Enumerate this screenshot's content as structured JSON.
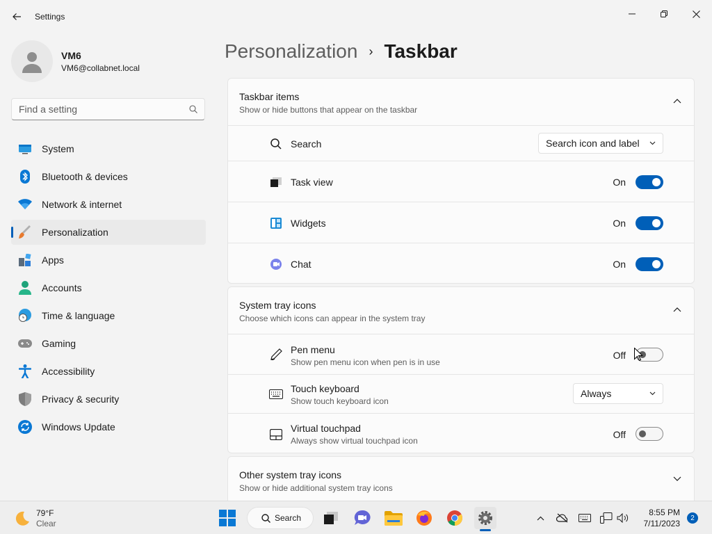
{
  "window": {
    "title": "Settings"
  },
  "profile": {
    "name": "VM6",
    "email": "VM6@collabnet.local"
  },
  "search": {
    "placeholder": "Find a setting"
  },
  "sidebar": {
    "items": [
      {
        "label": "System",
        "icon": "system-icon"
      },
      {
        "label": "Bluetooth & devices",
        "icon": "bluetooth-icon"
      },
      {
        "label": "Network & internet",
        "icon": "wifi-icon"
      },
      {
        "label": "Personalization",
        "icon": "brush-icon",
        "active": true
      },
      {
        "label": "Apps",
        "icon": "apps-icon"
      },
      {
        "label": "Accounts",
        "icon": "person-icon"
      },
      {
        "label": "Time & language",
        "icon": "globe-clock-icon"
      },
      {
        "label": "Gaming",
        "icon": "gamepad-icon"
      },
      {
        "label": "Accessibility",
        "icon": "accessibility-icon"
      },
      {
        "label": "Privacy & security",
        "icon": "shield-icon"
      },
      {
        "label": "Windows Update",
        "icon": "update-icon"
      }
    ]
  },
  "breadcrumb": {
    "parent": "Personalization",
    "separator": "›",
    "current": "Taskbar"
  },
  "taskbar_items": {
    "title": "Taskbar items",
    "subtitle": "Show or hide buttons that appear on the taskbar",
    "search": {
      "label": "Search",
      "value": "Search icon and label"
    },
    "task_view": {
      "label": "Task view",
      "state": "On"
    },
    "widgets": {
      "label": "Widgets",
      "state": "On"
    },
    "chat": {
      "label": "Chat",
      "state": "On"
    }
  },
  "system_tray": {
    "title": "System tray icons",
    "subtitle": "Choose which icons can appear in the system tray",
    "pen_menu": {
      "label": "Pen menu",
      "sub": "Show pen menu icon when pen is in use",
      "state": "Off"
    },
    "touch_keyboard": {
      "label": "Touch keyboard",
      "sub": "Show touch keyboard icon",
      "value": "Always"
    },
    "virtual_touchpad": {
      "label": "Virtual touchpad",
      "sub": "Always show virtual touchpad icon",
      "state": "Off"
    }
  },
  "other_tray": {
    "title": "Other system tray icons",
    "subtitle": "Show or hide additional system tray icons"
  },
  "taskbar": {
    "weather_temp": "79°F",
    "weather_cond": "Clear",
    "search_label": "Search",
    "time": "8:55 PM",
    "date": "7/11/2023",
    "notifications": "2"
  },
  "colors": {
    "accent": "#005fb8"
  }
}
